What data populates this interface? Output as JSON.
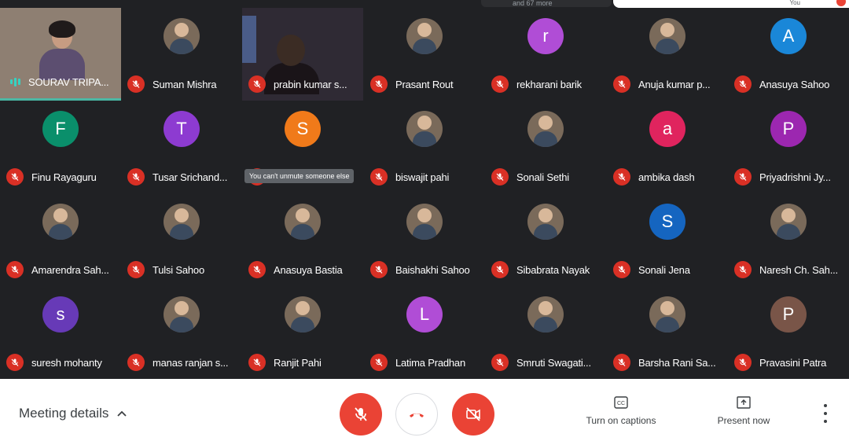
{
  "top": {
    "chip_text": "and 67 more",
    "self_label": "You"
  },
  "tiles": [
    {
      "name": "SOURAV TRIPA...",
      "type": "self-video"
    },
    {
      "name": "Suman Mishra",
      "type": "photo"
    },
    {
      "name": "prabin kumar s...",
      "type": "camera"
    },
    {
      "name": "Prasant Rout",
      "type": "photo"
    },
    {
      "name": "rekharani barik",
      "type": "letter",
      "letter": "r",
      "color": "#b04dd6"
    },
    {
      "name": "Anuja kumar p...",
      "type": "photo"
    },
    {
      "name": "Anasuya Sahoo",
      "type": "letter",
      "letter": "A",
      "color": "#1a87d8"
    },
    {
      "name": "Finu Rayaguru",
      "type": "letter",
      "letter": "F",
      "color": "#0a8f6b"
    },
    {
      "name": "Tusar Srichand...",
      "type": "letter",
      "letter": "T",
      "color": "#8d3bd1"
    },
    {
      "name": "",
      "type": "letter",
      "letter": "S",
      "color": "#f07a1a"
    },
    {
      "name": "biswajit pahi",
      "type": "photo"
    },
    {
      "name": "Sonali Sethi",
      "type": "photo"
    },
    {
      "name": "ambika dash",
      "type": "letter",
      "letter": "a",
      "color": "#e0245e"
    },
    {
      "name": "Priyadrishni Jy...",
      "type": "letter",
      "letter": "P",
      "color": "#9c27b0"
    },
    {
      "name": "Amarendra Sah...",
      "type": "photo"
    },
    {
      "name": "Tulsi Sahoo",
      "type": "photo"
    },
    {
      "name": "Anasuya Bastia",
      "type": "photo"
    },
    {
      "name": "Baishakhi Sahoo",
      "type": "photo"
    },
    {
      "name": "Sibabrata Nayak",
      "type": "photo"
    },
    {
      "name": "Sonali Jena",
      "type": "letter",
      "letter": "S",
      "color": "#1565c0"
    },
    {
      "name": "Naresh Ch. Sah...",
      "type": "photo"
    },
    {
      "name": "suresh mohanty",
      "type": "letter",
      "letter": "s",
      "color": "#673ab7"
    },
    {
      "name": "manas ranjan s...",
      "type": "photo"
    },
    {
      "name": "Ranjit Pahi",
      "type": "photo"
    },
    {
      "name": "Latima Pradhan",
      "type": "letter",
      "letter": "L",
      "color": "#b04dd6"
    },
    {
      "name": "Smruti Swagati...",
      "type": "photo"
    },
    {
      "name": "Barsha Rani Sa...",
      "type": "photo"
    },
    {
      "name": "Pravasini Patra",
      "type": "letter",
      "letter": "P",
      "color": "#795548"
    }
  ],
  "tooltip": "You can't unmute someone else",
  "bottom": {
    "meeting_details": "Meeting details",
    "captions_label": "Turn on captions",
    "present_label": "Present now"
  },
  "colors": {
    "mute_red": "#d93025",
    "control_red": "#ea4335",
    "speaking_teal": "#35d3c2"
  }
}
